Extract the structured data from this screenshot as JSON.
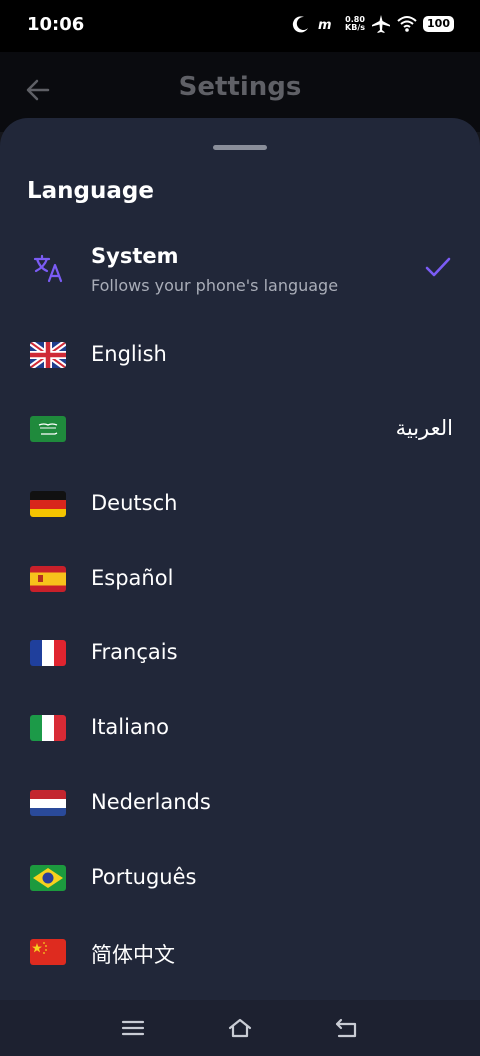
{
  "status": {
    "time": "10:06",
    "speed_value": "0.80",
    "speed_unit": "KB/s",
    "battery": "100",
    "icons": [
      "moon-icon",
      "mt-icon",
      "airplane-icon",
      "wifi-icon",
      "battery-icon"
    ]
  },
  "appbar": {
    "title": "Settings"
  },
  "sheet": {
    "title": "Language",
    "system": {
      "label": "System",
      "subtitle": "Follows your phone's language",
      "selected": true
    },
    "languages": [
      {
        "label": "English",
        "flag": "uk-flag-icon"
      },
      {
        "label": "العربية",
        "flag": "saudi-flag-icon"
      },
      {
        "label": "Deutsch",
        "flag": "germany-flag-icon"
      },
      {
        "label": "Español",
        "flag": "spain-flag-icon"
      },
      {
        "label": "Français",
        "flag": "france-flag-icon"
      },
      {
        "label": "Italiano",
        "flag": "italy-flag-icon"
      },
      {
        "label": "Nederlands",
        "flag": "netherlands-flag-icon"
      },
      {
        "label": "Português",
        "flag": "brazil-flag-icon"
      },
      {
        "label": "简体中文",
        "flag": "china-flag-icon"
      }
    ]
  },
  "colors": {
    "accent": "#7b5cf5",
    "sheet": "#212739",
    "background": "#0a0b0f"
  },
  "navbar": {
    "icons": [
      "menu-icon",
      "home-icon",
      "back-icon"
    ]
  }
}
